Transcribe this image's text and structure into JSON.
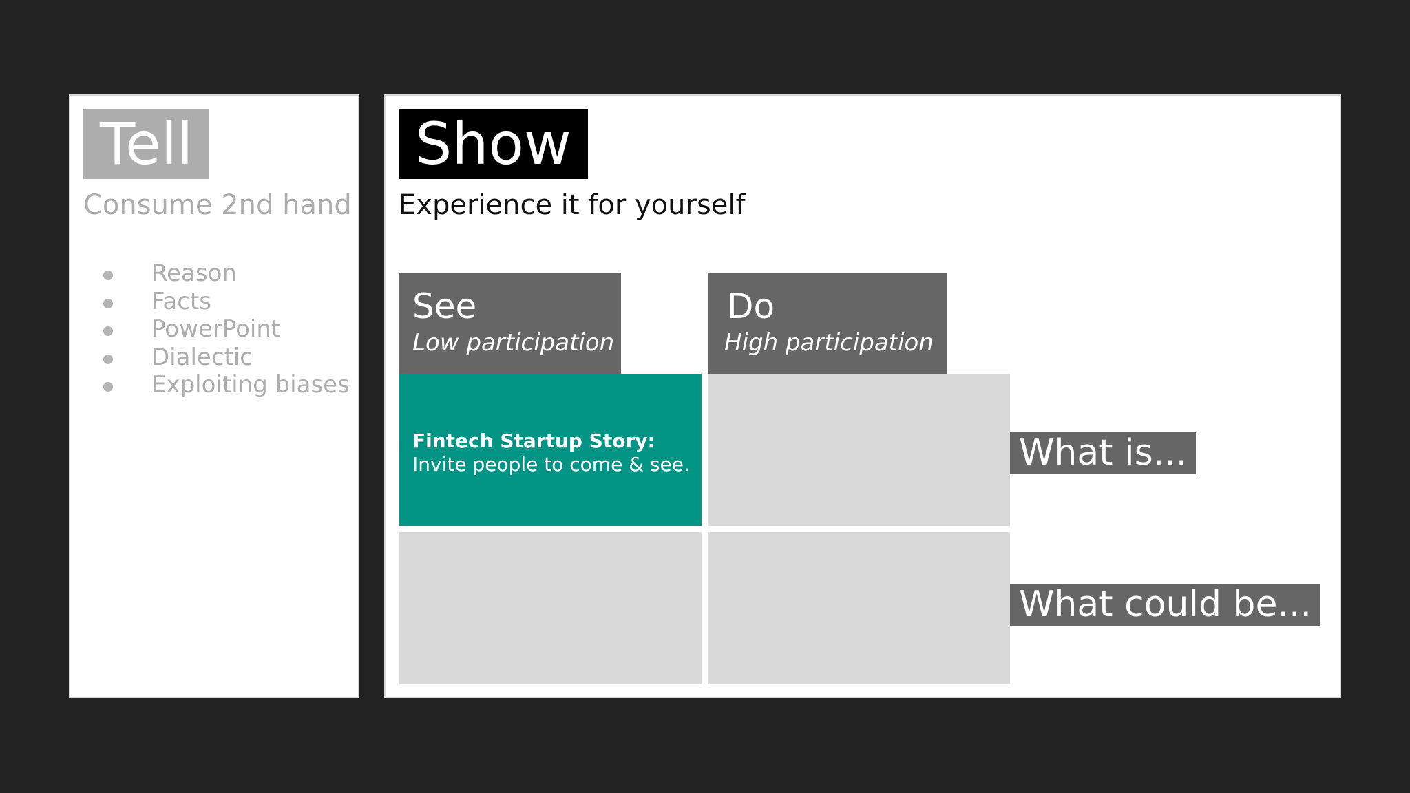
{
  "tell": {
    "title": "Tell",
    "subtitle": "Consume 2nd hand",
    "items": [
      "Reason",
      "Facts",
      "PowerPoint",
      "Dialectic",
      "Exploiting biases"
    ]
  },
  "show": {
    "title": "Show",
    "subtitle": "Experience it for yourself",
    "columns": [
      {
        "title": "See",
        "subtitle": "Low participation"
      },
      {
        "title": "Do",
        "subtitle": "High participation"
      }
    ],
    "rows": [
      {
        "label": "What is..."
      },
      {
        "label": "What could be..."
      }
    ],
    "story": {
      "title": "Fintech Startup Story:",
      "text": "Invite people to come & see."
    }
  },
  "colors": {
    "background": "#222222",
    "tell_accent": "#adadad",
    "show_accent": "#000000",
    "header_gray": "#666666",
    "highlight_teal": "#029485",
    "cell_gray": "#d9d9d9"
  }
}
